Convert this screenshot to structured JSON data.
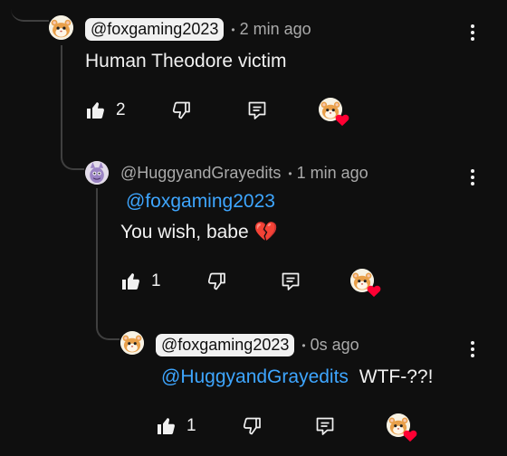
{
  "comments": [
    {
      "handle": "@foxgaming2023",
      "time": "2 min ago",
      "text": "Human Theodore victim",
      "likes": "2",
      "avatar": "hamster-avatar"
    },
    {
      "handle": "@HuggyandGrayedits",
      "time": "1 min ago",
      "mention": "@foxgaming2023",
      "text": "You wish, babe 💔",
      "likes": "1",
      "avatar": "purple-character-avatar"
    },
    {
      "handle": "@foxgaming2023",
      "time": "0s ago",
      "mention": "@HuggyandGrayedits",
      "text": "WTF-??!",
      "likes": "1",
      "avatar": "hamster-avatar"
    }
  ],
  "colors": {
    "background": "#0f0f0f",
    "mention": "#3ea6ff",
    "heart": "#ff0033",
    "meta": "#aaaaaa"
  },
  "icons": [
    "thumb-up-icon",
    "thumb-down-icon",
    "reply-icon",
    "creator-heart-icon",
    "more-vert-icon"
  ]
}
